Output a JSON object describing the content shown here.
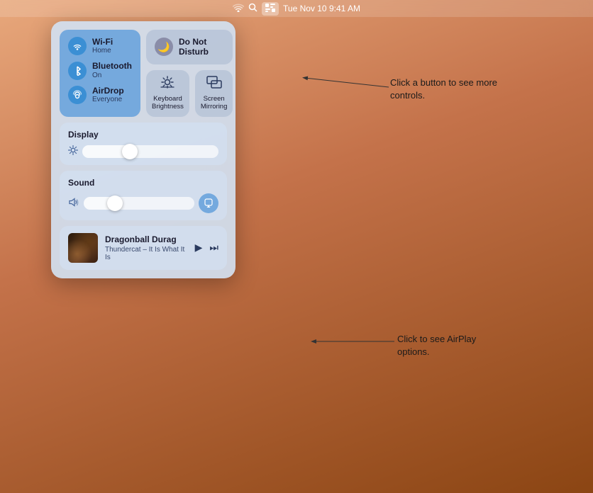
{
  "menubar": {
    "time": "Tue Nov 10  9:41 AM",
    "wifi_icon": "📶",
    "search_icon": "🔍",
    "control_center_icon": "⊞"
  },
  "network_tile": {
    "wifi": {
      "label": "Wi-Fi",
      "sublabel": "Home",
      "icon": "wifi"
    },
    "bluetooth": {
      "label": "Bluetooth",
      "sublabel": "On",
      "icon": "bluetooth"
    },
    "airdrop": {
      "label": "AirDrop",
      "sublabel": "Everyone",
      "icon": "airdrop"
    }
  },
  "dnd_tile": {
    "label_line1": "Do Not",
    "label_line2": "Disturb"
  },
  "icon_tiles": [
    {
      "symbol": "✶",
      "label": "Keyboard\nBrightness"
    },
    {
      "symbol": "⧉",
      "label": "Screen\nMirroring"
    }
  ],
  "display_section": {
    "title": "Display",
    "slider_value": 35
  },
  "sound_section": {
    "title": "Sound",
    "slider_value": 28
  },
  "music": {
    "title": "Dragonball Durag",
    "artist": "Thundercat – It Is What It Is",
    "play_btn": "▶",
    "forward_btn": "⏭"
  },
  "annotations": {
    "callout1": "Click a button to\nsee more controls.",
    "callout2": "Click to see\nAirPlay options."
  }
}
